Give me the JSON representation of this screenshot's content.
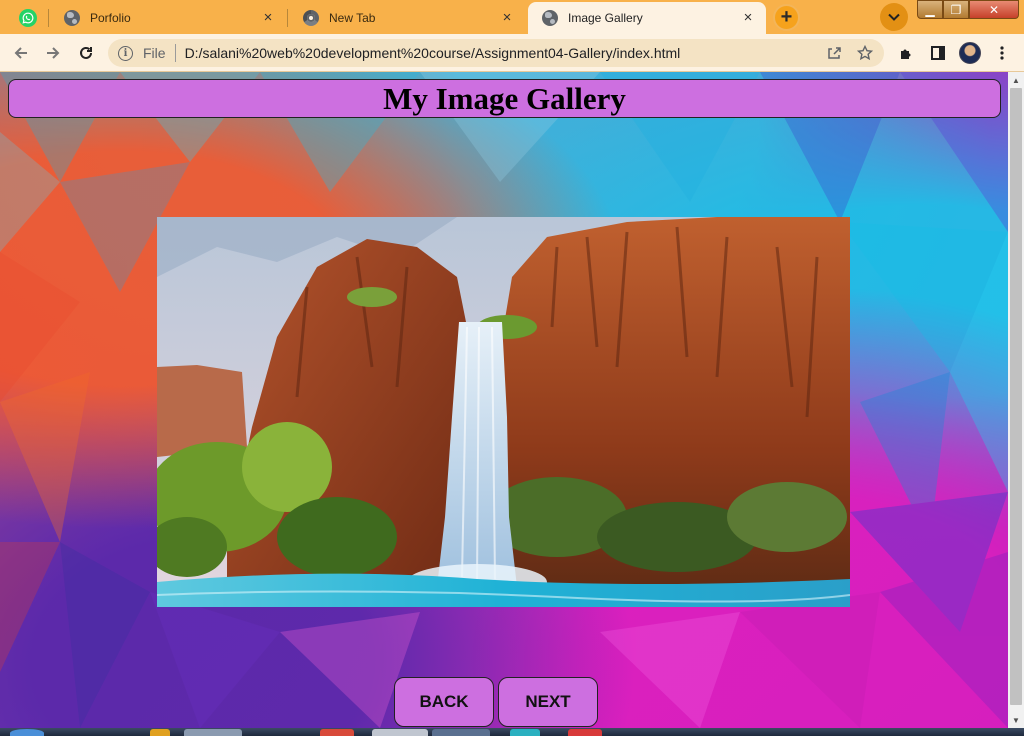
{
  "browser": {
    "tabs": [
      {
        "title": "",
        "pinned": true,
        "icon": "whatsapp-icon"
      },
      {
        "title": "Porfolio",
        "icon": "globe-icon"
      },
      {
        "title": "New Tab",
        "icon": "chrome-icon"
      },
      {
        "title": "Image Gallery",
        "icon": "globe-icon",
        "active": true
      }
    ],
    "close_glyph": "×",
    "new_tab_glyph": "+",
    "tab_search_glyph": "⌄",
    "window_controls": {
      "minimize": "▁",
      "maximize": "❐",
      "close": "✕"
    },
    "address_bar": {
      "scheme_label": "File",
      "url": "D:/salani%20web%20development%20course/Assignment04-Gallery/index.html"
    },
    "accent_color": "#f8b14a"
  },
  "page": {
    "title": "My Image Gallery",
    "image": {
      "subject": "waterfall over red canyon cliffs into turquoise pool"
    },
    "buttons": {
      "back": "BACK",
      "next": "NEXT"
    },
    "colors": {
      "header_bg": "#cd6fe0",
      "button_bg": "#cd6fe0"
    }
  }
}
